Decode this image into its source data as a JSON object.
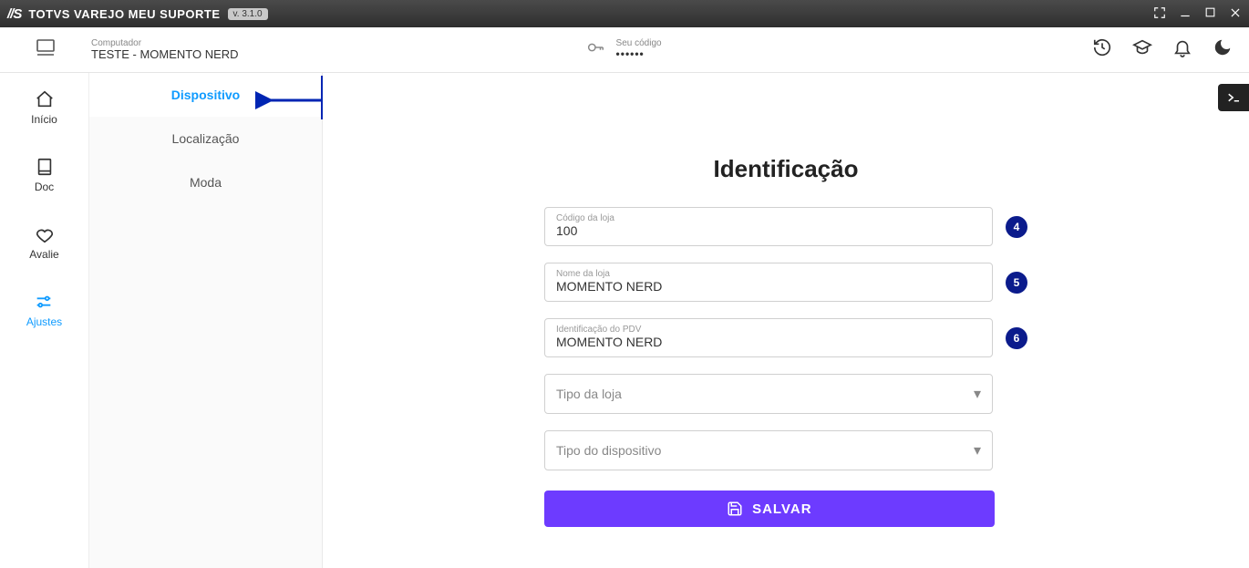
{
  "titlebar": {
    "logo": "//S",
    "app_name": "TOTVS VAREJO MEU SUPORTE",
    "version": "v. 3.1.0"
  },
  "infobar": {
    "computer_label": "Computador",
    "computer_value": "TESTE - MOMENTO NERD",
    "code_label": "Seu código",
    "code_value": "••••••"
  },
  "rail": {
    "inicio": "Início",
    "doc": "Doc",
    "avalie": "Avalie",
    "ajustes": "Ajustes"
  },
  "subside": {
    "dispositivo": "Dispositivo",
    "localizacao": "Localização",
    "moda": "Moda"
  },
  "form": {
    "title": "Identificação",
    "fields": {
      "codigo_loja": {
        "label": "Código da loja",
        "value": "100",
        "badge": "4"
      },
      "nome_loja": {
        "label": "Nome da loja",
        "value": "MOMENTO NERD",
        "badge": "5"
      },
      "id_pdv": {
        "label": "Identificação do PDV",
        "value": "MOMENTO NERD",
        "badge": "6"
      },
      "tipo_loja": {
        "placeholder": "Tipo da loja"
      },
      "tipo_disp": {
        "placeholder": "Tipo do dispositivo"
      }
    },
    "save_label": "SALVAR"
  }
}
